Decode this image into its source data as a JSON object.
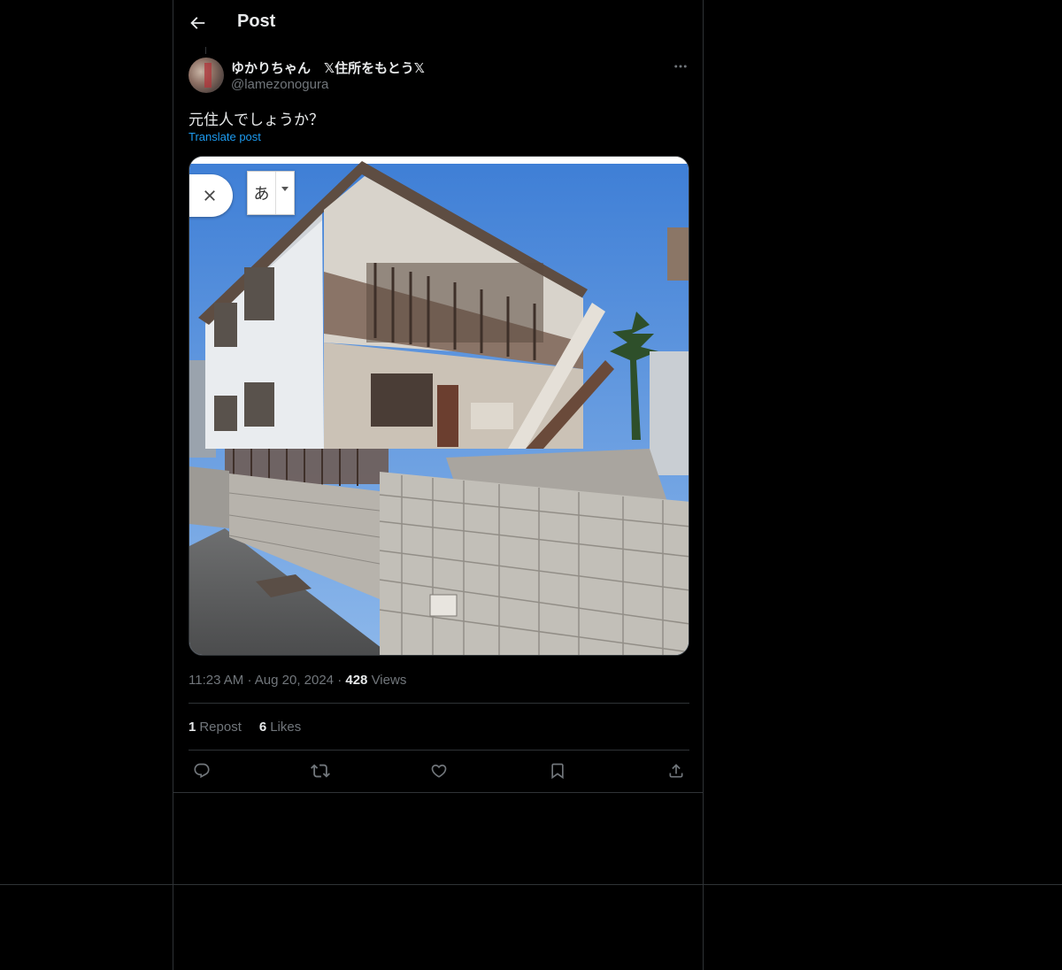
{
  "header": {
    "title": "Post"
  },
  "author": {
    "display_name": "ゆかりちゃん　𝕏住所をもとう𝕏",
    "handle": "@lamezonogura"
  },
  "post": {
    "text": "元住人でしょうか？",
    "translate_label": "Translate post",
    "media": {
      "ime_char": "あ"
    }
  },
  "meta": {
    "time": "11:23 AM",
    "sep1": "·",
    "date": "Aug 20, 2024",
    "sep2": "·",
    "views_count": "428",
    "views_label": "Views"
  },
  "stats": {
    "reposts_count": "1",
    "reposts_label": "Repost",
    "likes_count": "6",
    "likes_label": "Likes"
  },
  "icons": {
    "back": "arrow-left-icon",
    "more": "more-dots-icon",
    "reply": "reply-icon",
    "repost": "repost-icon",
    "like": "heart-icon",
    "bookmark": "bookmark-icon",
    "share": "share-icon"
  },
  "colors": {
    "background": "#000000",
    "text": "#e7e9ea",
    "secondary": "#71767b",
    "link": "#1d9bf0",
    "border": "#2f3336"
  }
}
